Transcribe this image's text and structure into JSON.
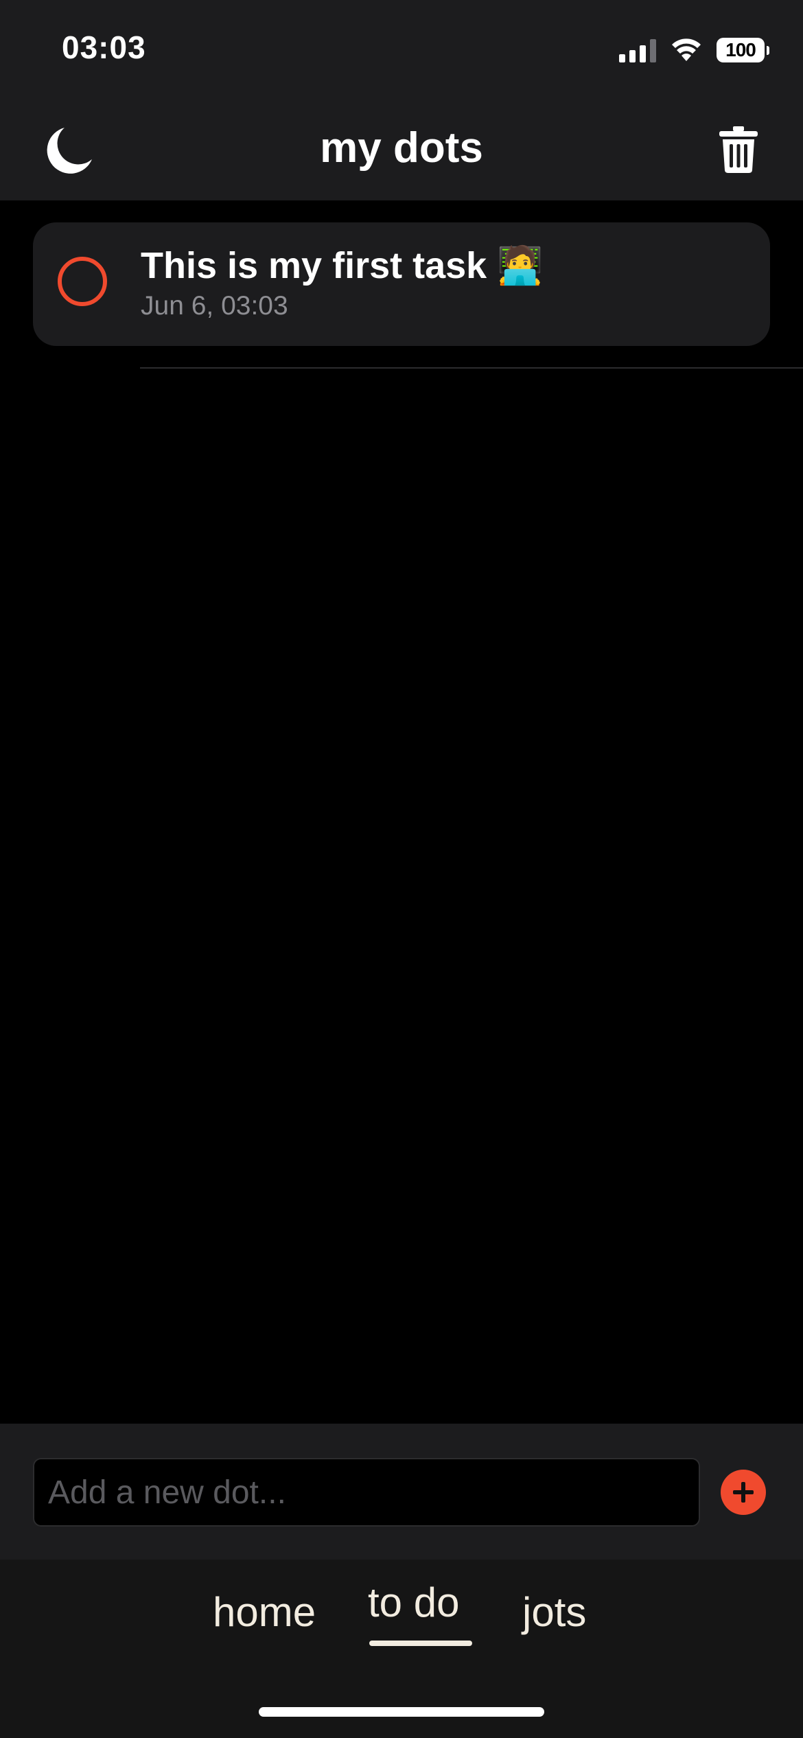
{
  "status_bar": {
    "time": "03:03",
    "battery": "100"
  },
  "header": {
    "title": "my dots",
    "left_icon": "moon-icon",
    "right_icon": "trash-icon"
  },
  "tasks": [
    {
      "title": "This is my first task 🧑‍💻",
      "date": "Jun 6, 03:03",
      "completed": false
    }
  ],
  "composer": {
    "placeholder": "Add a new dot...",
    "add_icon": "plus-icon"
  },
  "tabs": {
    "home": "home",
    "todo": "to do",
    "jots": "jots",
    "active": "to do"
  },
  "colors": {
    "accent": "#f04a2e",
    "surface": "#1c1c1e",
    "background": "#000000",
    "tab_text": "#f2ece0"
  }
}
